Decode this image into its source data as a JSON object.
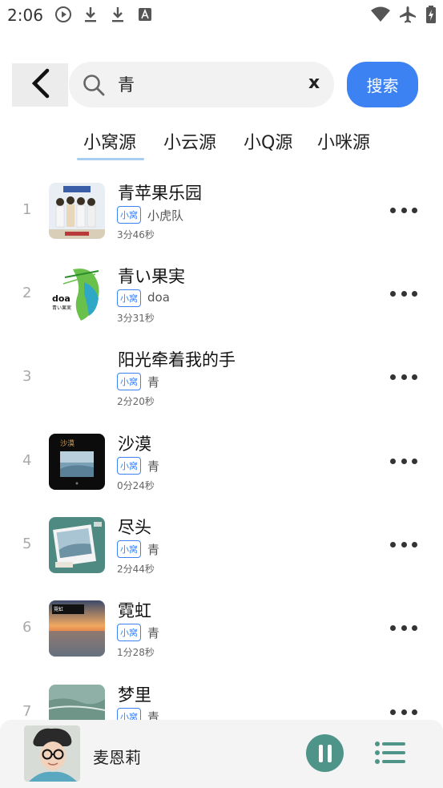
{
  "status_bar": {
    "time": "2:06",
    "icons": [
      "play-circle-icon",
      "download-icon",
      "download-icon",
      "text-a-icon",
      "wifi-icon",
      "airplane-icon",
      "battery-charging-icon"
    ]
  },
  "search": {
    "back_icon": "chevron-left-icon",
    "search_icon": "search-icon",
    "query": "青",
    "clear_label": "x",
    "button_label": "搜索"
  },
  "tabs": [
    {
      "label": "小窝源",
      "active": true
    },
    {
      "label": "小云源",
      "active": false
    },
    {
      "label": "小Q源",
      "active": false
    },
    {
      "label": "小咪源",
      "active": false
    }
  ],
  "songs": [
    {
      "index": "1",
      "title": "青苹果乐园",
      "badge": "小窝",
      "artist": "小虎队",
      "duration": "3分46秒"
    },
    {
      "index": "2",
      "title": "青い果実",
      "badge": "小窝",
      "artist": "doa",
      "duration": "3分31秒"
    },
    {
      "index": "3",
      "title": "阳光牵着我的手",
      "badge": "小窝",
      "artist": "青",
      "duration": "2分20秒"
    },
    {
      "index": "4",
      "title": "沙漠",
      "badge": "小窝",
      "artist": "青",
      "duration": "0分24秒"
    },
    {
      "index": "5",
      "title": "尽头",
      "badge": "小窝",
      "artist": "青",
      "duration": "2分44秒"
    },
    {
      "index": "6",
      "title": "霓虹",
      "badge": "小窝",
      "artist": "青",
      "duration": "1分28秒"
    },
    {
      "index": "7",
      "title": "梦里",
      "badge": "小窝",
      "artist": "青",
      "duration": ""
    }
  ],
  "cover_art": {
    "cover2_text": "doa",
    "cover2_subtext": "青い果実",
    "cover4_text": "沙漠",
    "cover6_text": "霓虹"
  },
  "player": {
    "now_playing": "麦恩莉",
    "pause_icon": "pause-icon",
    "playlist_icon": "playlist-icon"
  },
  "colors": {
    "accent": "#3d82f3",
    "player_button": "#4f9488",
    "tab_underline": "#a8cdf0"
  }
}
